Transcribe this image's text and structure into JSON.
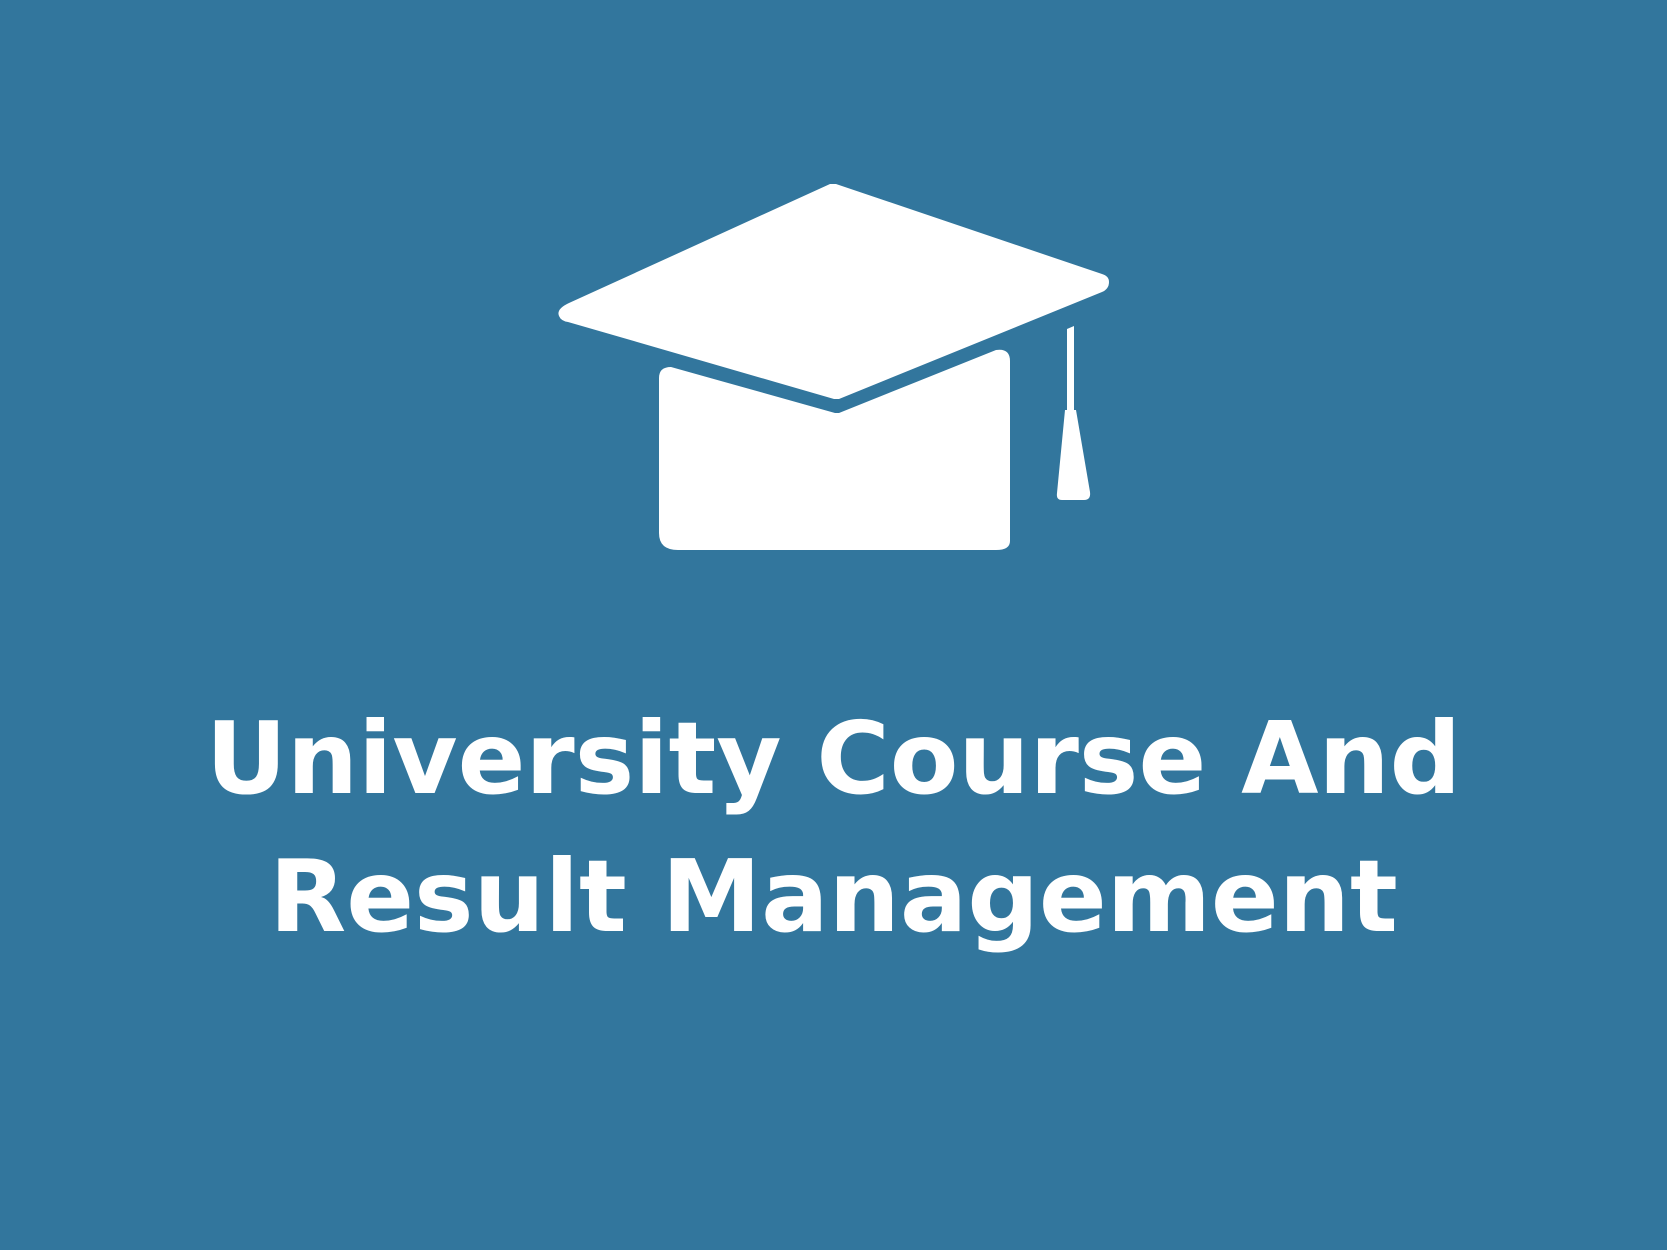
{
  "icon": {
    "name": "graduation-cap-icon",
    "color": "#ffffff"
  },
  "title": {
    "line1": "University Course And",
    "line2": "Result Management"
  },
  "colors": {
    "background": "#32769d",
    "foreground": "#ffffff"
  }
}
